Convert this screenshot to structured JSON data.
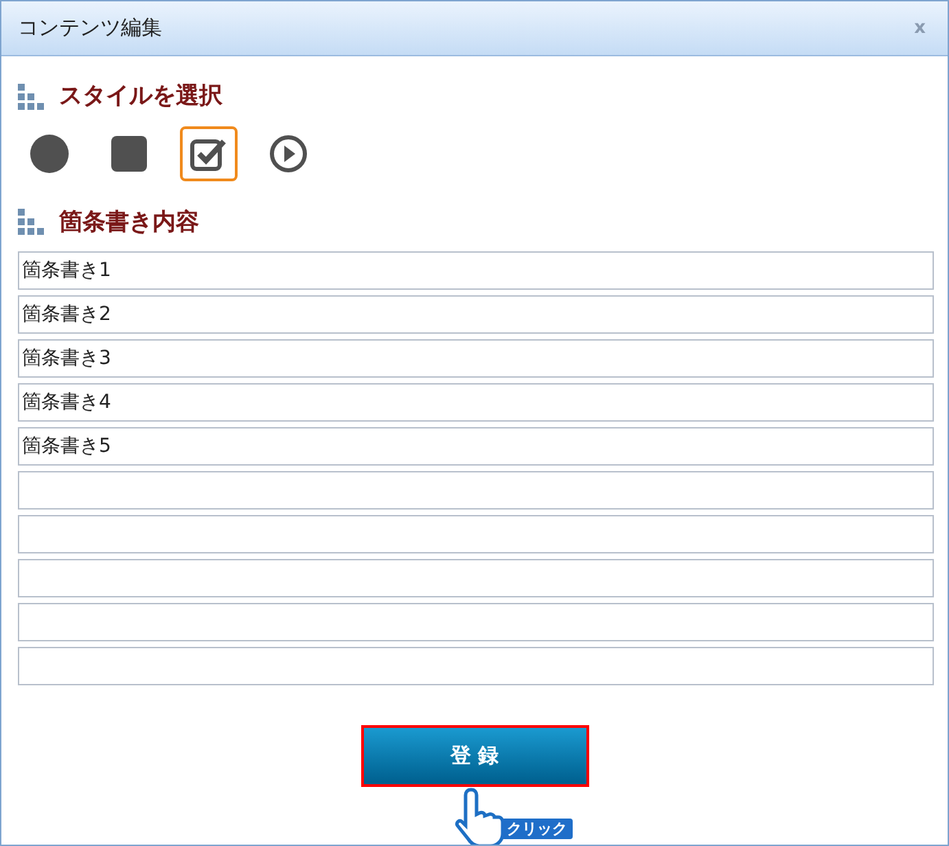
{
  "window": {
    "title": "コンテンツ編集",
    "close": "x"
  },
  "style_section": {
    "heading": "スタイルを選択",
    "styles": [
      {
        "kind": "circle",
        "selected": false
      },
      {
        "kind": "square",
        "selected": false
      },
      {
        "kind": "check",
        "selected": true
      },
      {
        "kind": "play",
        "selected": false
      }
    ]
  },
  "content_section": {
    "heading": "箇条書き内容",
    "fields": [
      {
        "kind": "filled",
        "value": "箇条書き1"
      },
      {
        "kind": "filled",
        "value": "箇条書き2"
      },
      {
        "kind": "filled",
        "value": "箇条書き3"
      },
      {
        "kind": "filled",
        "value": "箇条書き4"
      },
      {
        "kind": "filled",
        "value": "箇条書き5"
      },
      {
        "kind": "blank"
      },
      {
        "kind": "blank"
      },
      {
        "kind": "blank"
      },
      {
        "kind": "blank"
      },
      {
        "kind": "blank"
      }
    ]
  },
  "submit_button": {
    "label": "登 録",
    "highlighted": true
  },
  "pointer_callout": {
    "label": "クリック"
  }
}
